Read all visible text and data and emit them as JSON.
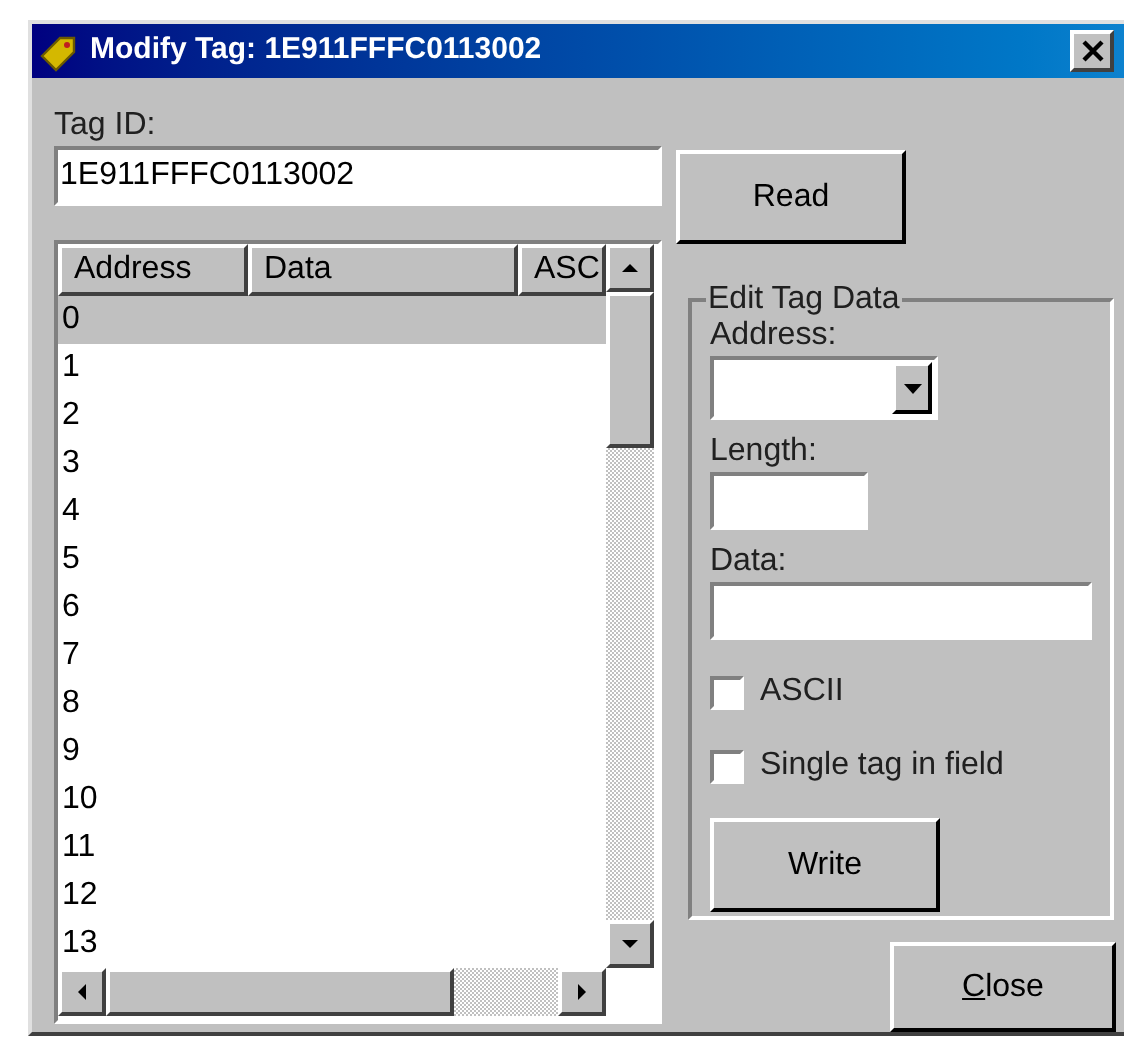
{
  "window": {
    "title": "Modify Tag: 1E911FFFC0113002"
  },
  "tag_id": {
    "label": "Tag ID:",
    "value": "1E911FFFC0113002"
  },
  "read_button": {
    "label": "Read"
  },
  "table": {
    "columns": [
      "Address",
      "Data",
      "ASC"
    ],
    "rows": [
      {
        "address": "0",
        "selected": true
      },
      {
        "address": "1",
        "selected": false
      },
      {
        "address": "2",
        "selected": false
      },
      {
        "address": "3",
        "selected": false
      },
      {
        "address": "4",
        "selected": false
      },
      {
        "address": "5",
        "selected": false
      },
      {
        "address": "6",
        "selected": false
      },
      {
        "address": "7",
        "selected": false
      },
      {
        "address": "8",
        "selected": false
      },
      {
        "address": "9",
        "selected": false
      },
      {
        "address": "10",
        "selected": false
      },
      {
        "address": "11",
        "selected": false
      },
      {
        "address": "12",
        "selected": false
      },
      {
        "address": "13",
        "selected": false
      }
    ]
  },
  "edit_group": {
    "title": "Edit Tag Data",
    "address_label": "Address:",
    "length_label": "Length:",
    "data_label": "Data:",
    "checkboxes": [
      {
        "label": "ASCII",
        "checked": false
      },
      {
        "label": "Single tag in field",
        "checked": false
      }
    ],
    "write_button": {
      "label": "Write"
    }
  },
  "close_button": {
    "label": "Close",
    "underline_first": true
  }
}
